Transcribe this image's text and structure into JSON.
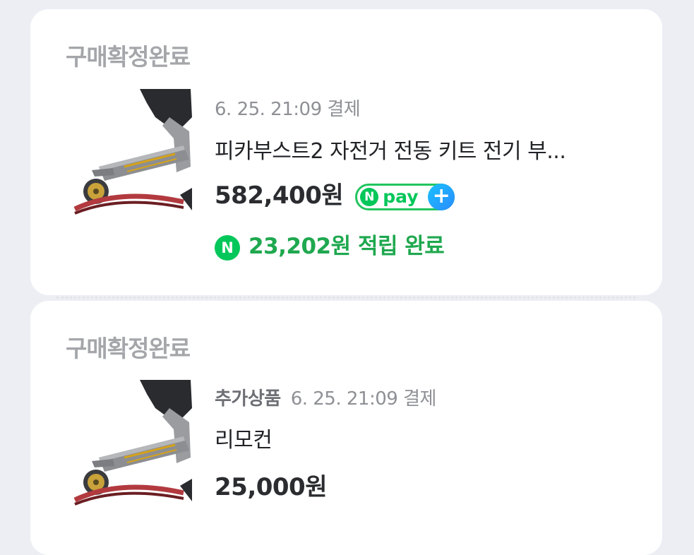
{
  "orders": [
    {
      "status": "구매확정완료",
      "meta": "6. 25. 21:09 결제",
      "title": "피카부스트2 자전거 전동 키트 전기 부...",
      "price": "582,400원",
      "badge": {
        "n": "N",
        "text": "pay",
        "plus": "+"
      },
      "reward": {
        "icon": "N",
        "text": "23,202원 적립 완료"
      }
    },
    {
      "status": "구매확정완료",
      "tag": "추가상품",
      "meta": "6. 25. 21:09 결제",
      "title": "리모컨",
      "price": "25,000원"
    }
  ],
  "colors": {
    "background": "#eceef4",
    "card": "#ffffff",
    "status": "#a4a6aa",
    "reward_green": "#1fa84f",
    "npay_green": "#03c75a",
    "npay_blue": "#2b8cff"
  },
  "icons": [
    "npay-badge-icon",
    "naver-point-icon",
    "ebike-kit-thumbnail"
  ]
}
